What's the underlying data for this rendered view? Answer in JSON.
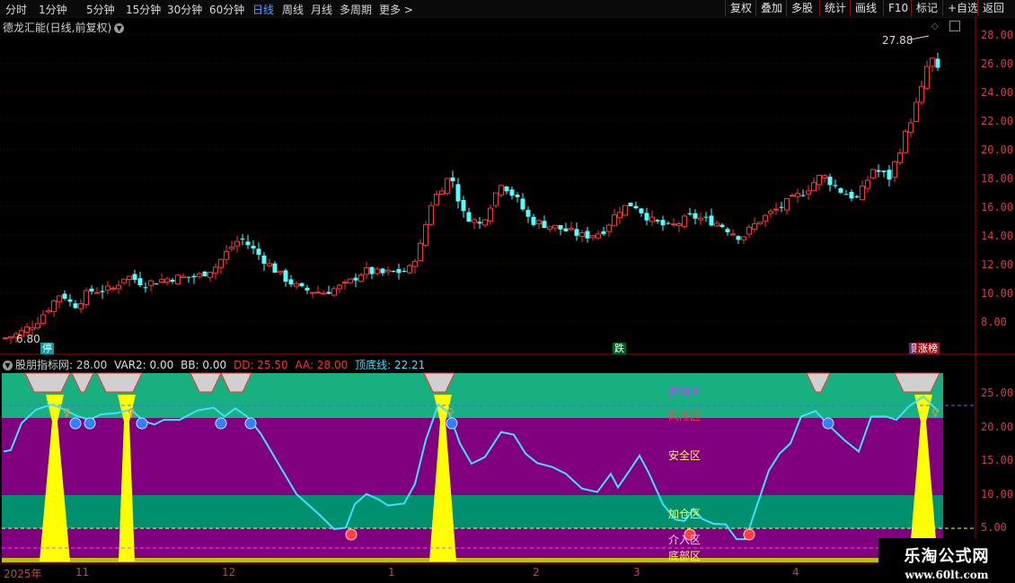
{
  "toolbar": {
    "periods": [
      "分时",
      "1分钟",
      "5分钟",
      "15分钟",
      "30分钟",
      "60分钟",
      "日线",
      "周线",
      "月线",
      "多周期",
      "更多 >"
    ],
    "active": "日线",
    "buttons": [
      "复权",
      "叠加",
      "多股",
      "统计",
      "画线",
      "F10",
      "标记",
      "+自选",
      "返回"
    ]
  },
  "main": {
    "title": "德龙汇能(日线,前复权)",
    "high_label": "27.88",
    "low_label": "6.80",
    "y_ticks": [
      "28.00",
      "26.00",
      "24.00",
      "22.00",
      "20.00",
      "18.00",
      "16.00",
      "14.00",
      "12.00",
      "10.00",
      "8.00"
    ],
    "markers": {
      "left": "停",
      "mid": "跌",
      "right_prefix": "则",
      "right": "涨榜"
    }
  },
  "indicator": {
    "title": "股朋指标网",
    "value": ": 28.00",
    "var2": "VAR2: 0.00",
    "bb": "BB: 0.00",
    "dd": "DD: 25.50",
    "aa": "AA: 28.00",
    "line": "顶底线: 22.21",
    "y_ticks": [
      "25.00",
      "20.00",
      "15.00",
      "10.00",
      "5.00"
    ],
    "zones": {
      "escape": "逃顶区",
      "risk": "风险区",
      "safe": "安全区",
      "add": "加仓区",
      "enter": "介入区",
      "bottom": "底部区"
    }
  },
  "x_axis": {
    "labels": [
      "2025年",
      "11",
      "12",
      "1",
      "2",
      "3",
      "4"
    ]
  },
  "watermark": {
    "line1": "乐淘公式网",
    "line2": "www.60lt.com"
  },
  "colors": {
    "up": "#ff3030",
    "down": "#54ffff",
    "axis": "#b00000",
    "band_top": "#18b080",
    "band_mid": "#800080",
    "band_low": "#009070",
    "yellow": "#ffff00",
    "line": "#40e0ff"
  }
}
